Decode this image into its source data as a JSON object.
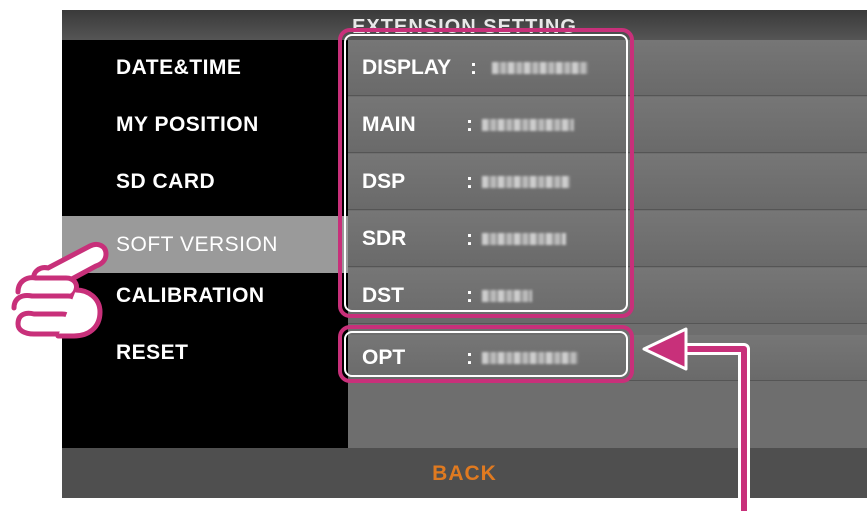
{
  "screen": {
    "title": "EXTENSION SETTING",
    "back_label": "BACK"
  },
  "sidebar": {
    "items": [
      {
        "label": "DATE&TIME"
      },
      {
        "label": "MY POSITION"
      },
      {
        "label": "SD CARD"
      },
      {
        "label": "SOFT VERSION",
        "selected": true
      },
      {
        "label": "CALIBRATION"
      },
      {
        "label": "RESET"
      }
    ]
  },
  "versions": {
    "rows": [
      {
        "label": "DISPLAY",
        "colon": ":"
      },
      {
        "label": "MAIN",
        "colon": ":"
      },
      {
        "label": "DSP",
        "colon": ":"
      },
      {
        "label": "SDR",
        "colon": ":"
      },
      {
        "label": "DST",
        "colon": ":"
      },
      {
        "label": "OPT",
        "colon": ":"
      }
    ]
  },
  "annotations": {
    "highlight_color": "#c8307a",
    "pointer_icon": "pointing-hand-icon",
    "arrow_icon": "arrow-left-icon"
  },
  "colors": {
    "back_text": "#e07a20",
    "sidebar_bg": "#000000",
    "selected_bg": "#9a9a9a"
  }
}
